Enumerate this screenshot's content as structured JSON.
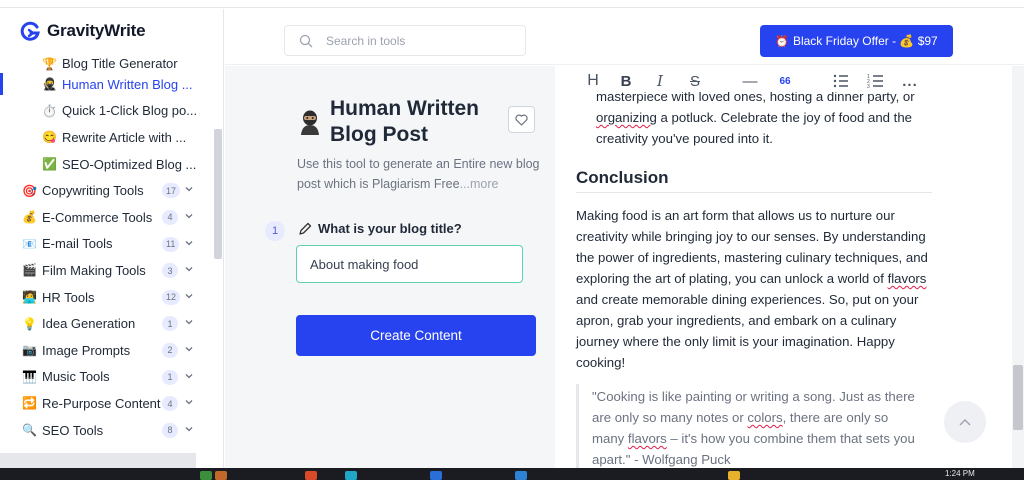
{
  "app": {
    "brand": "GravityWrite"
  },
  "sidebar": {
    "subitems": [
      {
        "emoji": "🏆",
        "label": "Blog Title Generator",
        "active": false
      },
      {
        "emoji": "🥷",
        "label": "Human Written Blog ...",
        "active": true
      },
      {
        "emoji": "⏱️",
        "label": "Quick 1-Click Blog po...",
        "active": false
      },
      {
        "emoji": "😋",
        "label": "Rewrite Article with ...",
        "active": false
      },
      {
        "emoji": "✅",
        "label": "SEO-Optimized Blog ...",
        "active": false
      }
    ],
    "categories": [
      {
        "emoji": "🎯",
        "label": "Copywriting Tools",
        "count": "17"
      },
      {
        "emoji": "💰",
        "label": "E-Commerce Tools",
        "count": "4"
      },
      {
        "emoji": "📧",
        "label": "E-mail Tools",
        "count": "11"
      },
      {
        "emoji": "🎬",
        "label": "Film Making Tools",
        "count": "3"
      },
      {
        "emoji": "🧑‍💻",
        "label": "HR Tools",
        "count": "12"
      },
      {
        "emoji": "💡",
        "label": "Idea Generation",
        "count": "1"
      },
      {
        "emoji": "📷",
        "label": "Image Prompts",
        "count": "2"
      },
      {
        "emoji": "🎹",
        "label": "Music Tools",
        "count": "1"
      },
      {
        "emoji": "🔁",
        "label": "Re-Purpose Content",
        "count": "4"
      },
      {
        "emoji": "🔍",
        "label": "SEO Tools",
        "count": "8"
      }
    ]
  },
  "header": {
    "search_placeholder": "Search in tools",
    "offer_label": "Black Friday Offer - 💰 $97"
  },
  "tool": {
    "title_line1": "Human Written",
    "title_line2": "Blog Post",
    "description": "Use this tool to generate an Entire new blog post which is Plagiarism Free",
    "more": "...more",
    "step": "1",
    "question": "What is your blog title?",
    "answer": "About making food",
    "create_label": "Create Content"
  },
  "editor": {
    "toolbar": [
      "H",
      "B",
      "I",
      "S",
      "—",
      "66",
      "bullet-list",
      "numbered-list",
      "..."
    ],
    "para1": "masterpiece with loved ones, hosting a dinner party, or organizing a potluck. Celebrate the joy of food and the creativity you've poured into it.",
    "heading": "Conclusion",
    "para2": "Making food is an art form that allows us to nurture our creativity while bringing joy to our senses. By understanding the power of ingredients, mastering culinary techniques, and exploring the art of plating, you can unlock a world of flavors and create memorable dining experiences. So, put on your apron, grab your ingredients, and embark on a culinary journey where the only limit is your imagination. Happy cooking!",
    "quote": "\"Cooking is like painting or writing a song. Just as there are only so many notes or colors, there are only so many flavors – it's how you combine them that sets you apart.\" - Wolfgang Puck"
  },
  "taskbar": {
    "time": "1:24 PM"
  },
  "colors": {
    "accent": "#2743ef",
    "input_border": "#5fd0b6",
    "badge_bg": "#e8ebff"
  }
}
